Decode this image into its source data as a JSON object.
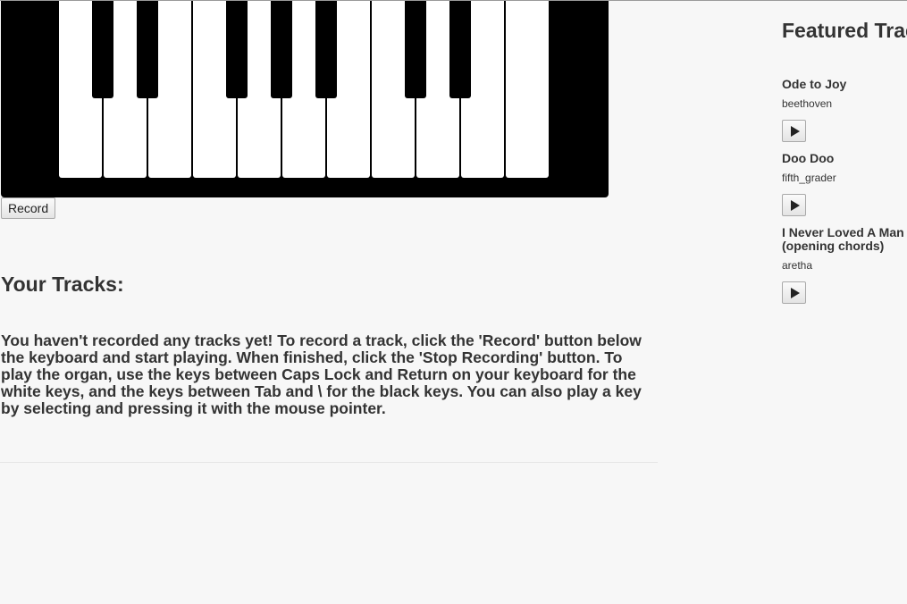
{
  "keyboard": {
    "white_keys": 11,
    "black_keys": 7
  },
  "record_button": {
    "label": "Record"
  },
  "your_tracks": {
    "title": "Your Tracks:",
    "empty_message": "You haven't recorded any tracks yet! To record a track, click the 'Record' button below the keyboard and start playing. When finished, click the 'Stop Recording' button. To play the organ, use the keys between Caps Lock and Return on your keyboard for the white keys, and the keys between Tab and \\ for the black keys. You can also play a key by selecting and pressing it with the mouse pointer."
  },
  "featured": {
    "title": "Featured Tracks",
    "tracks": [
      {
        "title": "Ode to Joy",
        "author": "beethoven",
        "play_icon": "play-icon"
      },
      {
        "title": "Doo Doo",
        "author": "fifth_grader",
        "play_icon": "play-icon"
      },
      {
        "title": "I Never Loved A Man (opening chords)",
        "author": "aretha",
        "play_icon": "play-icon"
      }
    ]
  }
}
